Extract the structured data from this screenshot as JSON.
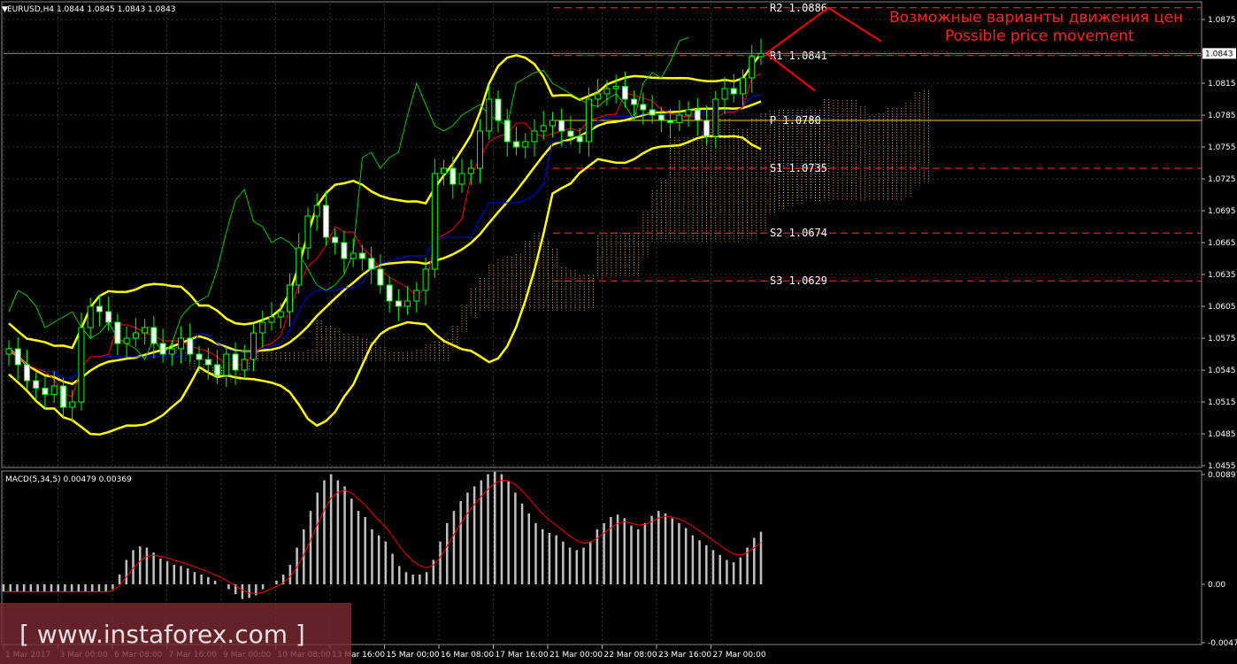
{
  "header": {
    "symbol_text": "EURUSD,H4  1.0844 1.0845 1.0843 1.0843",
    "macd_text": "MACD(5,34,5) 0.00479 0.00369"
  },
  "annotation": {
    "ru": "Возможные варианты движения цен",
    "en": "Possible price movement"
  },
  "watermark": "[ www.instaforex.com ]",
  "colors": {
    "background": "#000000",
    "grid": "#2a3a2a",
    "bull": "#00ff00",
    "bear_body": "#ffffff",
    "bollinger": "#ffff00",
    "tenkan": "#ff0000",
    "kijun": "#0000ff",
    "chikou": "#00cc00",
    "kumo": "#ffb27a",
    "pivot_level": "#ff3030",
    "pivot_p": "#ffcc00",
    "macd_hist": "#c0c0c0",
    "macd_signal": "#ff0000",
    "price_tag_bg": "#ffffff"
  },
  "chart_data": [
    {
      "type": "candlestick",
      "title": "EURUSD,H4",
      "y_ticks": [
        "1.0875",
        "1.0845",
        "1.0815",
        "1.0785",
        "1.0755",
        "1.0725",
        "1.0695",
        "1.0665",
        "1.0635",
        "1.0605",
        "1.0575",
        "1.0545",
        "1.0515",
        "1.0485",
        "1.0455"
      ],
      "ylim": [
        1.0455,
        1.089
      ],
      "current_price": "1.0843",
      "x_ticks": [
        "1 Mar 2017",
        "3 Mar 00:00",
        "6 Mar 08:00",
        "7 Mar 16:00",
        "9 Mar 00:00",
        "10 Mar 08:00",
        "13 Mar 16:00",
        "15 Mar 00:00",
        "16 Mar 08:00",
        "17 Mar 16:00",
        "21 Mar 00:00",
        "22 Mar 08:00",
        "23 Mar 16:00",
        "27 Mar 00:00"
      ],
      "levels": [
        {
          "name": "R2",
          "value": 1.0886,
          "label": "R2  1.0886"
        },
        {
          "name": "R1",
          "value": 1.0841,
          "label": "R1  1.0841"
        },
        {
          "name": "P",
          "value": 1.078,
          "label": "P  1.0780"
        },
        {
          "name": "S1",
          "value": 1.0735,
          "label": "S1  1.0735"
        },
        {
          "name": "S2",
          "value": 1.0674,
          "label": "S2  1.0674"
        },
        {
          "name": "S3",
          "value": 1.0629,
          "label": "S3  1.0629"
        }
      ],
      "closes": [
        1.0565,
        1.055,
        1.0535,
        1.0528,
        1.0522,
        1.053,
        1.051,
        1.0515,
        1.0585,
        1.0605,
        1.06,
        1.059,
        1.057,
        1.0575,
        1.058,
        1.0585,
        1.057,
        1.056,
        1.0565,
        1.0575,
        1.056,
        1.0555,
        1.055,
        1.054,
        1.056,
        1.0545,
        1.0555,
        1.058,
        1.059,
        1.0595,
        1.06,
        1.0625,
        1.066,
        1.069,
        1.07,
        1.067,
        1.0665,
        1.065,
        1.0655,
        1.065,
        1.064,
        1.0625,
        1.061,
        1.0605,
        1.061,
        1.062,
        1.064,
        1.073,
        1.0735,
        1.072,
        1.073,
        1.0735,
        1.077,
        1.08,
        1.078,
        1.076,
        1.0755,
        1.076,
        1.077,
        1.0775,
        1.078,
        1.077,
        1.0765,
        1.076,
        1.08,
        1.0805,
        1.081,
        1.0812,
        1.08,
        1.0795,
        1.079,
        1.0785,
        1.078,
        1.0778,
        1.0785,
        1.079,
        1.078,
        1.0765,
        1.08,
        1.081,
        1.0805,
        1.082,
        1.084,
        1.0843
      ]
    },
    {
      "type": "bar",
      "title": "MACD(5,34,5)",
      "y_ticks": [
        "0.00897",
        "0.00",
        "-0.00477"
      ],
      "ylim": [
        -0.00477,
        0.00897
      ],
      "values": [
        -0.0006,
        -0.0006,
        -0.0006,
        -0.0006,
        -0.0006,
        -0.0006,
        -0.0006,
        -0.0006,
        -0.0006,
        -0.0006,
        -0.0006,
        -0.0006,
        -0.0006,
        -0.0006,
        -0.0006,
        -0.0006,
        -0.0004,
        0.0008,
        0.002,
        0.0028,
        0.0031,
        0.003,
        0.0026,
        0.0021,
        0.0019,
        0.0016,
        0.0015,
        0.0013,
        0.001,
        0.0008,
        0.0006,
        0.0003,
        0.0,
        -0.0004,
        -0.0008,
        -0.0012,
        -0.0011,
        -0.0009,
        -0.0004,
        0.0,
        0.0003,
        0.0008,
        0.0016,
        0.003,
        0.0045,
        0.006,
        0.0075,
        0.0085,
        0.009,
        0.0085,
        0.008,
        0.007,
        0.006,
        0.0055,
        0.0045,
        0.004,
        0.0035,
        0.0025,
        0.0015,
        0.001,
        0.0008,
        0.0008,
        0.001,
        0.002,
        0.0035,
        0.005,
        0.006,
        0.0068,
        0.0075,
        0.008,
        0.0085,
        0.009,
        0.0092,
        0.009,
        0.0084,
        0.0075,
        0.0066,
        0.0058,
        0.005,
        0.0045,
        0.0042,
        0.004,
        0.0035,
        0.003,
        0.0028,
        0.003,
        0.0035,
        0.0045,
        0.005,
        0.0055,
        0.0057,
        0.0054,
        0.0048,
        0.0045,
        0.005,
        0.0056,
        0.006,
        0.0058,
        0.0054,
        0.005,
        0.0046,
        0.004,
        0.0036,
        0.0032,
        0.0028,
        0.0024,
        0.002,
        0.0018,
        0.0022,
        0.003,
        0.0038,
        0.0043
      ]
    }
  ]
}
